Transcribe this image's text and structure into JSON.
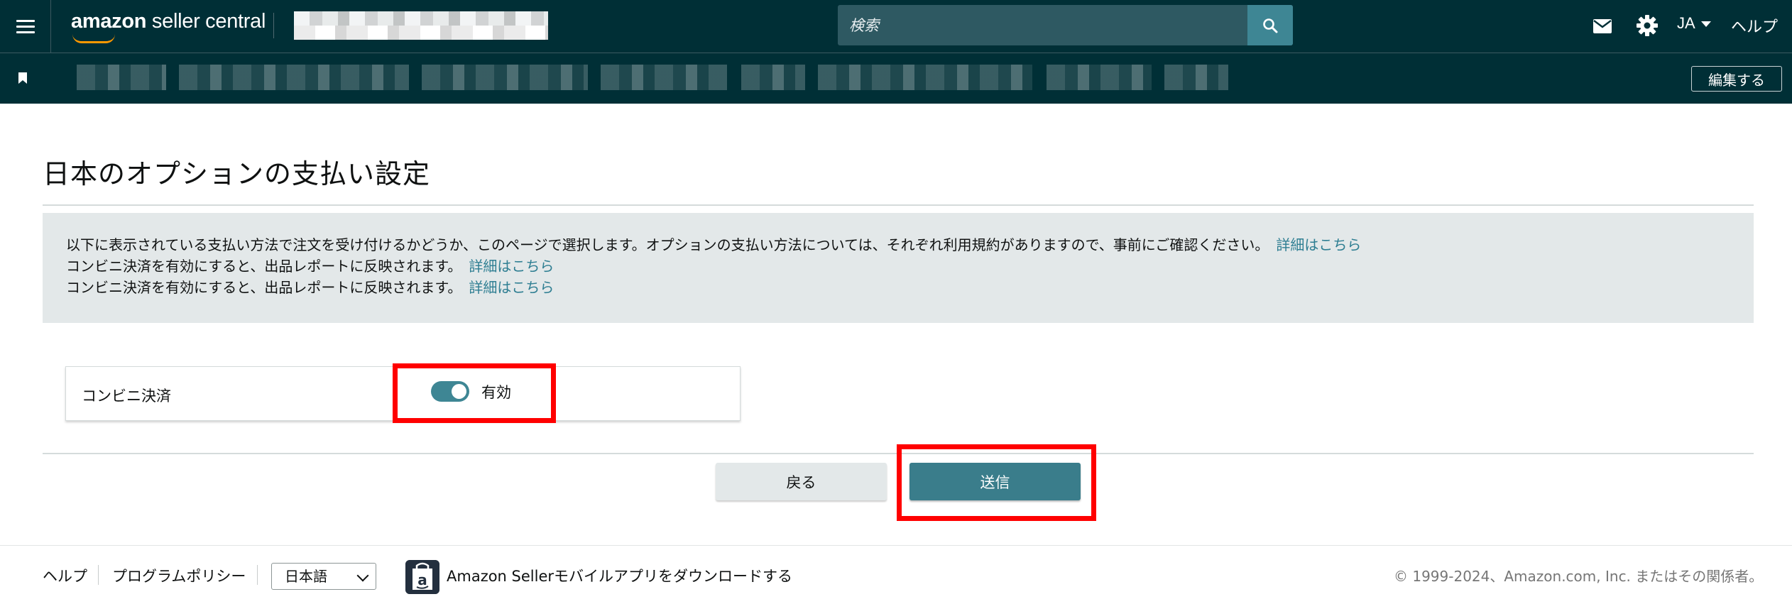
{
  "header": {
    "logo_text_bold": "amazon",
    "logo_text_rest": " seller central",
    "search_placeholder": "検索",
    "language": "JA",
    "help": "ヘルプ"
  },
  "bookmarks": {
    "edit_label": "編集する"
  },
  "main": {
    "title": "日本のオプションの支払い設定",
    "info_lines": [
      {
        "text": "以下に表示されている支払い方法で注文を受け付けるかどうか、このページで選択します。オプションの支払い方法については、それぞれ利用規約がありますので、事前にご確認ください。",
        "link": "詳細はこちら"
      },
      {
        "text": "コンビニ決済を有効にすると、出品レポートに反映されます。",
        "link": "詳細はこちら"
      },
      {
        "text": "コンビニ決済を有効にすると、出品レポートに反映されます。",
        "link": "詳細はこちら"
      }
    ],
    "setting": {
      "label": "コンビニ決済",
      "toggle_state": "有効",
      "enabled": true
    },
    "buttons": {
      "back": "戻る",
      "submit": "送信"
    }
  },
  "footer": {
    "help": "ヘルプ",
    "policy": "プログラムポリシー",
    "language_selected": "日本語",
    "app_download": "Amazon Sellerモバイルアプリをダウンロードする",
    "copyright": "© 1999-2024、Amazon.com, Inc. またはその関係者。"
  },
  "colors": {
    "nav_bg": "#002f36",
    "search_bg": "#2e5962",
    "accent": "#3e8694",
    "highlight": "#ff0000",
    "link": "#2e7e92"
  }
}
